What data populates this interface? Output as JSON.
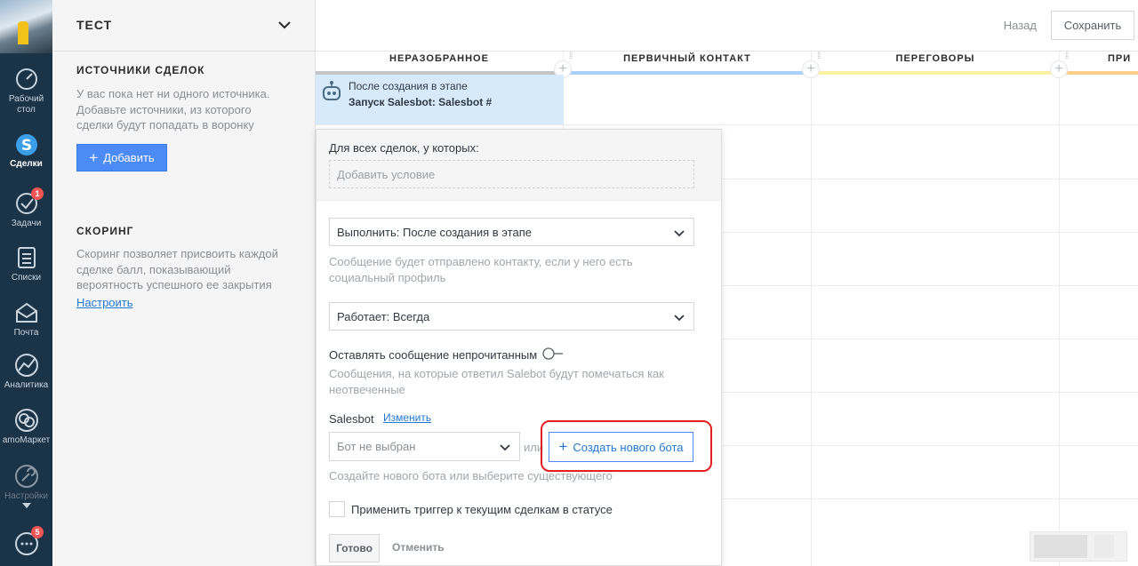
{
  "appnav": {
    "items": [
      {
        "label": "Рабочий стол",
        "icon": "dashboard-icon"
      },
      {
        "label": "Сделки",
        "icon": "deals-icon"
      },
      {
        "label": "Задачи",
        "icon": "tasks-icon",
        "badge": "1"
      },
      {
        "label": "Списки",
        "icon": "lists-icon"
      },
      {
        "label": "Почта",
        "icon": "mail-icon"
      },
      {
        "label": "Аналитика",
        "icon": "analytics-icon"
      },
      {
        "label": "amoМаркет",
        "icon": "market-icon"
      },
      {
        "label": "Настройки",
        "icon": "settings-icon"
      }
    ],
    "chat_badge": "5"
  },
  "panel": {
    "title": "ТЕСТ",
    "sources": {
      "title": "ИСТОЧНИКИ СДЕЛОК",
      "text": "У вас пока нет ни одного источника. Добавьте источники, из которого сделки будут попадать в воронку",
      "add_label": "Добавить"
    },
    "scoring": {
      "title": "СКОРИНГ",
      "text": "Скоринг позволяет присвоить каждой сделке балл, показывающий вероятность успешного ее закрытия",
      "link": "Настроить"
    }
  },
  "topbar": {
    "back_label": "Назад",
    "save_label": "Сохранить"
  },
  "board": {
    "columns": [
      {
        "title": "НЕРАЗОБРАННОЕ",
        "color": "#c2c6c9"
      },
      {
        "title": "ПЕРВИЧНЫЙ КОНТАКТ",
        "color": "#99ccff"
      },
      {
        "title": "ПЕРЕГОВОРЫ",
        "color": "#fff000"
      },
      {
        "title": "ПРИ",
        "color": "#ffcc66"
      }
    ],
    "trigger": {
      "line1": "После создания в этапе",
      "line2": "Запуск Salesbot: Salesbot #"
    }
  },
  "popup": {
    "for_all_label": "Для всех сделок, у которых:",
    "condition_placeholder": "Добавить условие",
    "execute_select": "Выполнить: После создания в этапе",
    "execute_hint": "Сообщение будет отправлено контакту, если у него есть социальный профиль",
    "works_select": "Работает: Всегда",
    "unread_label": "Оставлять сообщение непрочитанным",
    "unread_hint": "Сообщения, на которые ответил Salebot будут помечаться как неотвеченные",
    "salesbot_label": "Salesbot",
    "change_link": "Изменить",
    "bot_select": "Бот не выбран",
    "or_text": "или",
    "create_bot_label": "Создать нового бота",
    "bot_hint": "Создайте нового бота или выберите существующего",
    "apply_label": "Применить триггер к текущим сделкам в статусе",
    "done_label": "Готово",
    "cancel_label": "Отменить"
  }
}
